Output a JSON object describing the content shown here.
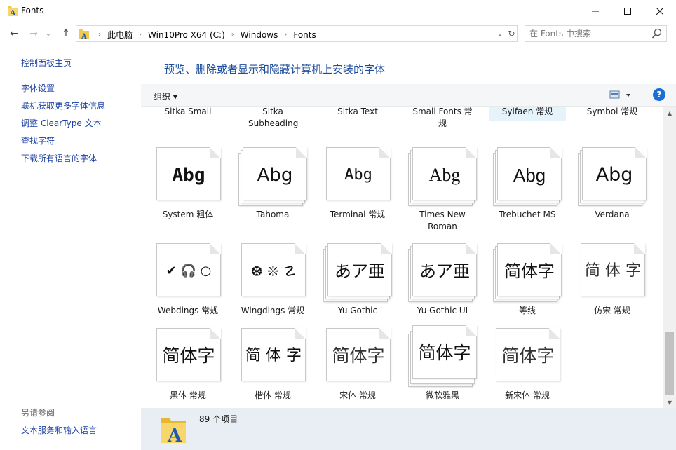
{
  "window": {
    "title": "Fonts"
  },
  "address": {
    "crumbs": [
      "此电脑",
      "Win10Pro X64 (C:)",
      "Windows",
      "Fonts"
    ]
  },
  "search": {
    "placeholder": "在 Fonts 中搜索"
  },
  "left_pane": {
    "home_link": "控制面板主页",
    "links": [
      "字体设置",
      "联机获取更多字体信息",
      "调整 ClearType 文本",
      "查找字符",
      "下载所有语言的字体"
    ],
    "see_also_title": "另请参阅",
    "see_also_links": [
      "文本服务和输入语言"
    ]
  },
  "main": {
    "headline": "预览、删除或者显示和隐藏计算机上安装的字体",
    "organize_label": "组织 ▾",
    "help_label": "?"
  },
  "fonts": {
    "row0": [
      {
        "name": "Sitka Small"
      },
      {
        "name": "Sitka Subheading"
      },
      {
        "name": "Sitka Text"
      },
      {
        "name": "Small Fonts 常规"
      },
      {
        "name": "Sylfaen 常规"
      },
      {
        "name": "Symbol 常规"
      }
    ],
    "row1": [
      {
        "name": "System 粗体",
        "sample": "Abg"
      },
      {
        "name": "Tahoma",
        "sample": "Abg"
      },
      {
        "name": "Terminal 常规",
        "sample": "Abg"
      },
      {
        "name": "Times New Roman",
        "sample": "Abg"
      },
      {
        "name": "Trebuchet MS",
        "sample": "Abg"
      },
      {
        "name": "Verdana",
        "sample": "Abg"
      }
    ],
    "row2": [
      {
        "name": "Webdings 常规",
        "sample": "✔ 🎧 ○"
      },
      {
        "name": "Wingdings 常规",
        "sample": "❆ ❊ ☡"
      },
      {
        "name": "Yu Gothic",
        "sample": "あア亜"
      },
      {
        "name": "Yu Gothic UI",
        "sample": "あア亜"
      },
      {
        "name": "等线",
        "sample": "简体字"
      },
      {
        "name": "仿宋 常规",
        "sample": "简 体 字"
      }
    ],
    "row3": [
      {
        "name": "黑体 常规",
        "sample": "简体字"
      },
      {
        "name": "楷体 常规",
        "sample": "简 体 字"
      },
      {
        "name": "宋体 常规",
        "sample": "简体字"
      },
      {
        "name": "微软雅黑",
        "sample": "简体字"
      },
      {
        "name": "新宋体 常规",
        "sample": "简体字"
      }
    ]
  },
  "status": {
    "count_text": "89 个项目"
  },
  "colors": {
    "link": "#1a3fa0",
    "headline": "#1e4e9c",
    "selection": "#e5f3fb",
    "status_bg": "#e9eef5",
    "help_blue": "#1a6fd8"
  }
}
